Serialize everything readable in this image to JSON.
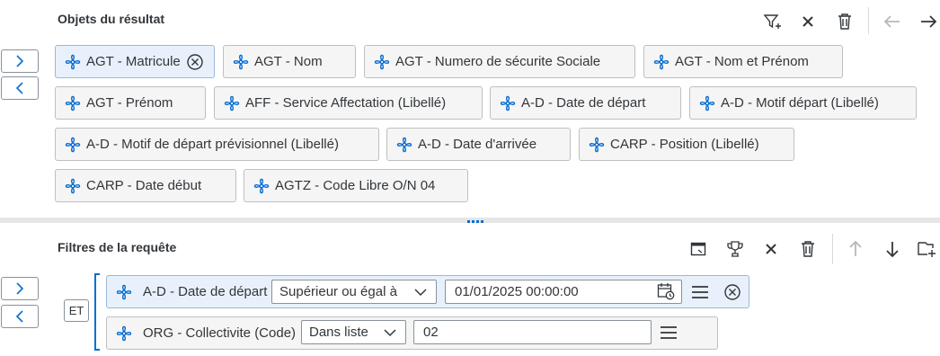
{
  "result_section": {
    "title": "Objets du résultat",
    "toolbar": {
      "filter_icon": "filter-add-icon",
      "clear_icon": "close-icon",
      "delete_icon": "trash-icon",
      "back_icon": "arrow-left-icon",
      "forward_icon": "arrow-right-icon"
    },
    "objects": [
      {
        "label": "AGT - Matricule",
        "selected": true
      },
      {
        "label": "AGT - Nom"
      },
      {
        "label": "AGT - Numero de sécurite Sociale"
      },
      {
        "label": "AGT - Nom et Prénom"
      },
      {
        "label": "AGT - Prénom"
      },
      {
        "label": "AFF - Service Affectation (Libellé)"
      },
      {
        "label": "A-D - Date de départ"
      },
      {
        "label": "A-D - Motif départ (Libellé)"
      },
      {
        "label": "A-D - Motif de départ prévisionnel (Libellé)"
      },
      {
        "label": "A-D - Date d'arrivée"
      },
      {
        "label": "CARP - Position (Libellé)"
      },
      {
        "label": "CARP - Date début"
      },
      {
        "label": "AGTZ - Code Libre O/N 04"
      }
    ]
  },
  "filters_section": {
    "title": "Filtres de la requête",
    "operator": "ET",
    "rows": [
      {
        "field": "A-D - Date de départ",
        "condition": "Supérieur ou égal à",
        "value": "01/01/2025 00:00:00"
      },
      {
        "field": "ORG - Collectivite (Code)",
        "condition": "Dans liste",
        "value": "02"
      }
    ]
  },
  "colors": {
    "accent": "#0a6ed1",
    "selected_token_bg": "#e8f1fb",
    "token_bg": "#f5f5f5"
  }
}
